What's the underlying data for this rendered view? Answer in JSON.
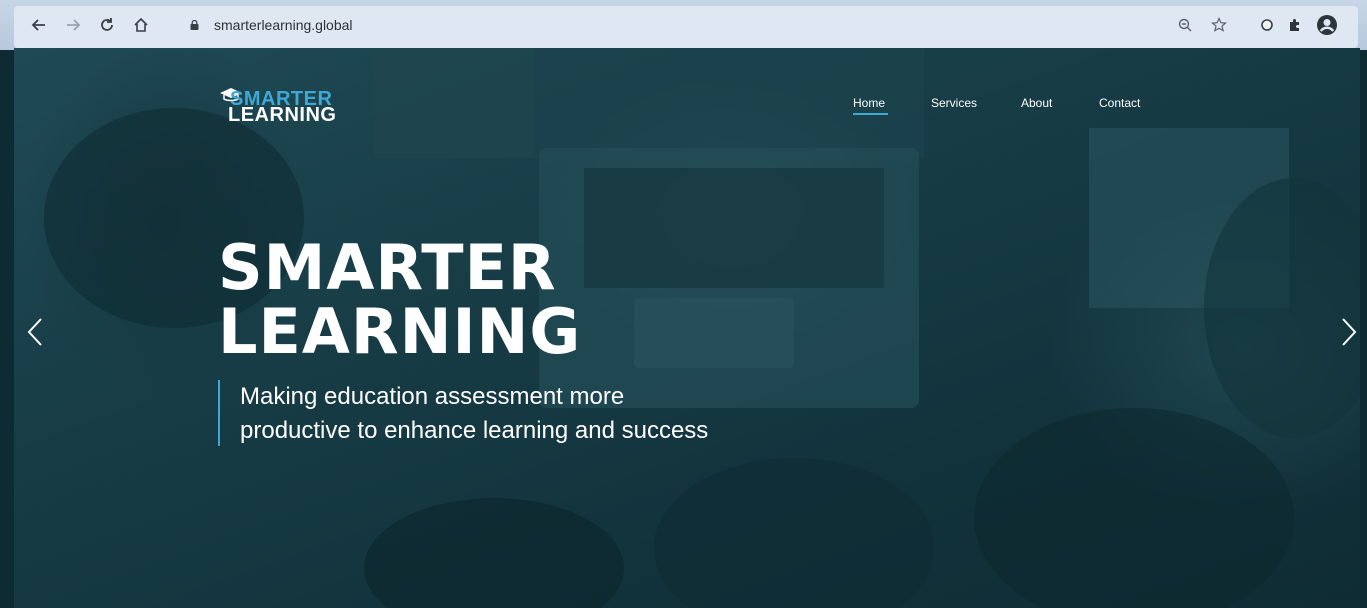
{
  "browser": {
    "url": "smarterlearning.global",
    "icons": {
      "back": "back-arrow-icon",
      "forward": "forward-arrow-icon",
      "reload": "reload-icon",
      "home": "home-icon",
      "lock": "lock-icon",
      "zoom": "zoom-icon",
      "bookmark": "star-icon",
      "extension1": "circle-extension-icon",
      "extensions": "puzzle-icon",
      "profile": "account-icon"
    }
  },
  "site": {
    "logo": {
      "line1": "SMARTER",
      "line2": "LEARNING"
    },
    "nav": [
      {
        "label": "Home",
        "active": true
      },
      {
        "label": "Services",
        "active": false
      },
      {
        "label": "About",
        "active": false
      },
      {
        "label": "Contact",
        "active": false
      }
    ],
    "hero": {
      "title_line1": "SMARTER",
      "title_line2": "LEARNING",
      "subtitle_line1": "Making education assessment more",
      "subtitle_line2": "productive to enhance learning and success"
    },
    "carousel": {
      "prev": "chevron-left-icon",
      "next": "chevron-right-icon"
    },
    "colors": {
      "accent": "#3fa8d6",
      "overlay": "#163a44",
      "text": "#ffffff"
    }
  }
}
